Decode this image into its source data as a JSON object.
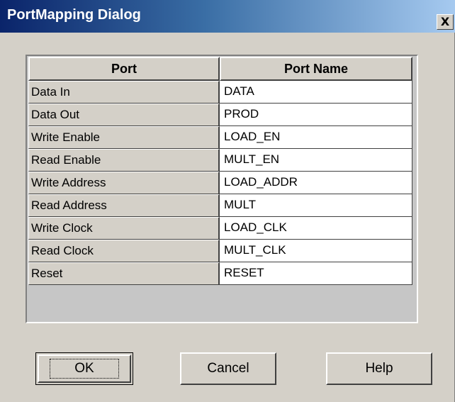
{
  "window": {
    "title": "PortMapping Dialog",
    "close_glyph": "X"
  },
  "table": {
    "headers": {
      "port": "Port",
      "port_name": "Port Name"
    },
    "rows": [
      {
        "port": "Data In",
        "port_name": "DATA"
      },
      {
        "port": "Data Out",
        "port_name": "PROD"
      },
      {
        "port": "Write Enable",
        "port_name": "LOAD_EN"
      },
      {
        "port": "Read Enable",
        "port_name": "MULT_EN"
      },
      {
        "port": "Write Address",
        "port_name": "LOAD_ADDR"
      },
      {
        "port": "Read Address",
        "port_name": "MULT"
      },
      {
        "port": "Write Clock",
        "port_name": "LOAD_CLK"
      },
      {
        "port": "Read Clock",
        "port_name": "MULT_CLK"
      },
      {
        "port": "Reset",
        "port_name": "RESET"
      }
    ]
  },
  "buttons": {
    "ok": "OK",
    "cancel": "Cancel",
    "help": "Help"
  },
  "colors": {
    "title_gradient_start": "#0a246a",
    "title_gradient_end": "#a6caf0",
    "face": "#d4d0c8"
  }
}
